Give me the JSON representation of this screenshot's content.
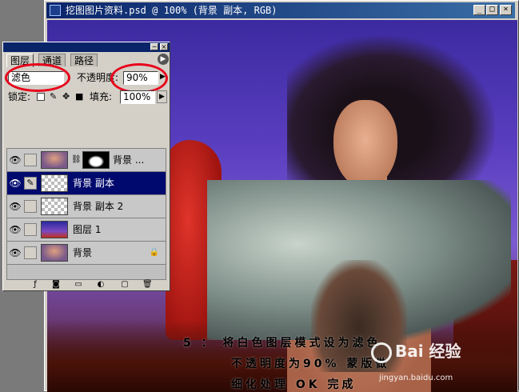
{
  "document": {
    "title": "挖图图片资料.psd @ 100% (背景 副本, RGB)",
    "window_buttons": [
      "_",
      "□",
      "×"
    ],
    "caption_lines": [
      "5 ： 将白色图层模式设为滤色",
      "不透明度为90%  蒙版做",
      "细化处理    OK  完成"
    ],
    "watermark": "Bai 经验",
    "watermark_url": "jingyan.baidu.com"
  },
  "layers_panel": {
    "tabs": [
      "图层",
      "通道",
      "路径"
    ],
    "active_tab": 0,
    "blend_mode": "滤色",
    "opacity_label": "不透明度:",
    "opacity_value": "90%",
    "lock_label": "锁定:",
    "fill_label": "填充:",
    "fill_value": "100%",
    "layers": [
      {
        "name": "背景 ...",
        "visible": true,
        "has_mask": true,
        "selected": false
      },
      {
        "name": "背景 副本",
        "visible": true,
        "has_mask": false,
        "selected": true
      },
      {
        "name": "背景 副本 2",
        "visible": true,
        "has_mask": false,
        "selected": false
      },
      {
        "name": "图层 1",
        "visible": true,
        "has_mask": false,
        "selected": false
      },
      {
        "name": "背景",
        "visible": true,
        "has_mask": false,
        "selected": false,
        "locked": true
      }
    ],
    "bottom_icons": [
      "link-layers-icon",
      "add-style-icon",
      "add-mask-icon",
      "new-set-icon",
      "adjustment-layer-icon",
      "new-layer-icon",
      "trash-icon"
    ]
  },
  "colors": {
    "highlight_ring": "#e8001a",
    "selected_row": "#000a6e",
    "titlebar": "#0a246a"
  }
}
